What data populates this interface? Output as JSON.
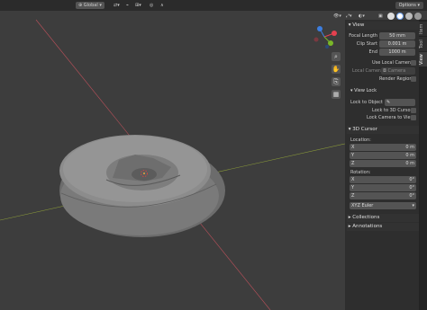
{
  "header": {
    "orientation_select": "Global",
    "options_label": "Options"
  },
  "tabs": [
    "Item",
    "Tool",
    "View"
  ],
  "view_section": {
    "title": "View",
    "focal_length_label": "Focal Length",
    "focal_length_value": "50 mm",
    "clip_start_label": "Clip Start",
    "clip_start_value": "0.001 m",
    "end_label": "End",
    "end_value": "1000 m",
    "use_local_camera_label": "Use Local Camera",
    "local_camera_label": "Local Camera",
    "local_camera_value": "Camera",
    "render_region_label": "Render Region"
  },
  "view_lock_section": {
    "title": "View Lock",
    "lock_to_object_label": "Lock to Object",
    "lock_to_3d_cursor_label": "Lock to 3D Cursor",
    "lock_camera_to_view_label": "Lock Camera to View"
  },
  "cursor_section": {
    "title": "3D Cursor",
    "location_label": "Location:",
    "location": [
      {
        "axis": "X",
        "value": "0 m"
      },
      {
        "axis": "Y",
        "value": "0 m"
      },
      {
        "axis": "Z",
        "value": "0 m"
      }
    ],
    "rotation_label": "Rotation:",
    "rotation": [
      {
        "axis": "X",
        "value": "0°"
      },
      {
        "axis": "Y",
        "value": "0°"
      },
      {
        "axis": "Z",
        "value": "0°"
      }
    ],
    "rotation_mode": "XYZ Euler"
  },
  "collections_title": "Collections",
  "annotations_title": "Annotations",
  "gizmo": {
    "x_color": "#e5404f",
    "y_color": "#7ab728",
    "z_color": "#3c7ee0"
  }
}
